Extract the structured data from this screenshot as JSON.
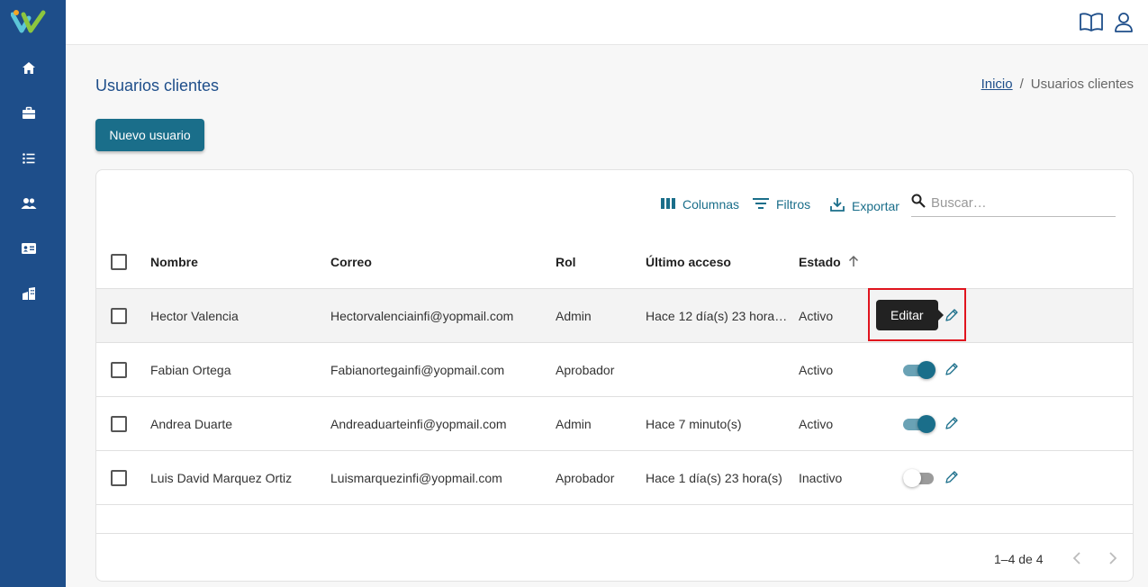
{
  "colors": {
    "sidebar": "#1e4e8a",
    "primary": "#1a6e8a",
    "highlight": "#e0141e"
  },
  "sidebar": {
    "logo": "app-logo",
    "items": [
      {
        "icon": "home-icon"
      },
      {
        "icon": "briefcase-icon"
      },
      {
        "icon": "list-icon"
      },
      {
        "icon": "users-icon"
      },
      {
        "icon": "id-card-icon"
      },
      {
        "icon": "building-icon"
      }
    ]
  },
  "topbar": {
    "icons": [
      "book-icon",
      "user-icon"
    ]
  },
  "page": {
    "title": "Usuarios clientes"
  },
  "breadcrumb": {
    "home": "Inicio",
    "separator": "/",
    "current": "Usuarios clientes"
  },
  "actions": {
    "new_user": "Nuevo usuario"
  },
  "toolbar": {
    "columns": "Columnas",
    "filters": "Filtros",
    "export": "Exportar",
    "search_placeholder": "Buscar…"
  },
  "table": {
    "headers": {
      "name": "Nombre",
      "email": "Correo",
      "role": "Rol",
      "last_access": "Último acceso",
      "status": "Estado"
    },
    "sort": {
      "column": "Estado",
      "direction": "asc"
    },
    "rows": [
      {
        "name": "Hector Valencia",
        "email": "Hectorvalenciainfi@yopmail.com",
        "role": "Admin",
        "last_access": "Hace 12 día(s) 23 hora…",
        "status": "Activo",
        "enabled": true
      },
      {
        "name": "Fabian Ortega",
        "email": "Fabianortegainfi@yopmail.com",
        "role": "Aprobador",
        "last_access": "",
        "status": "Activo",
        "enabled": true
      },
      {
        "name": "Andrea Duarte",
        "email": "Andreaduarteinfi@yopmail.com",
        "role": "Admin",
        "last_access": "Hace 7 minuto(s)",
        "status": "Activo",
        "enabled": true
      },
      {
        "name": "Luis David Marquez Ortiz",
        "email": "Luismarquezinfi@yopmail.com",
        "role": "Aprobador",
        "last_access": "Hace 1 día(s) 23 hora(s)",
        "status": "Inactivo",
        "enabled": false
      }
    ]
  },
  "tooltip": {
    "text": "Editar"
  },
  "pagination": {
    "label": "1–4 de 4"
  }
}
